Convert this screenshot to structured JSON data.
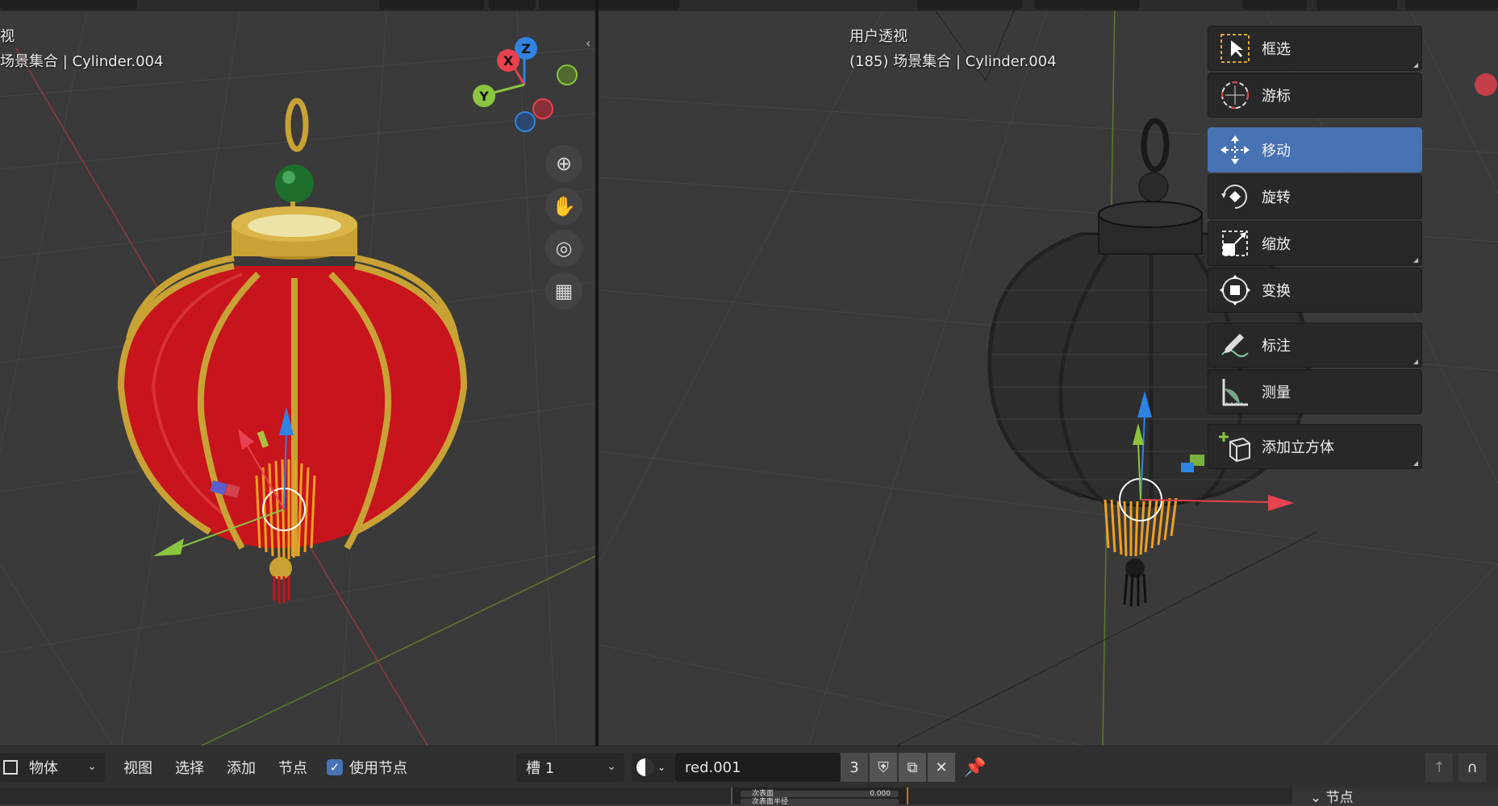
{
  "left_viewport": {
    "view_name": "视",
    "collection_info": "场景集合 | Cylinder.004",
    "gizmo_labels": {
      "z": "Z",
      "x": "X",
      "y": "Y"
    }
  },
  "right_viewport": {
    "view_name": "用户透视",
    "collection_info": "(185) 场景集合 | Cylinder.004"
  },
  "toolbar": {
    "items": [
      {
        "label": "框选",
        "icon": "select-box-icon"
      },
      {
        "label": "游标",
        "icon": "cursor-icon"
      },
      {
        "label": "移动",
        "icon": "move-icon",
        "active": true
      },
      {
        "label": "旋转",
        "icon": "rotate-icon"
      },
      {
        "label": "缩放",
        "icon": "scale-icon"
      },
      {
        "label": "变换",
        "icon": "transform-icon"
      },
      {
        "label": "标注",
        "icon": "annotate-icon"
      },
      {
        "label": "测量",
        "icon": "measure-icon"
      },
      {
        "label": "添加立方体",
        "icon": "add-cube-icon"
      }
    ]
  },
  "footer": {
    "object_mode": "物体",
    "menu": {
      "view": "视图",
      "select": "选择",
      "add": "添加",
      "node": "节点"
    },
    "use_nodes_label": "使用节点",
    "slot": "槽 1",
    "material_name": "red.001",
    "user_count": "3"
  },
  "bottom_strip": {
    "node_panel_label": "节点",
    "mini_field_1_label": "次表面",
    "mini_field_1_value": "0.000",
    "mini_field_2_label": "次表面半径"
  },
  "colors": {
    "accent": "#4772b3",
    "viewport_bg": "#3a3a3a",
    "axis_x": "#e8414f",
    "axis_y": "#8bc53f",
    "axis_z": "#2f84e3",
    "lantern_red": "#c8141c",
    "lantern_gold": "#c9a235",
    "tassel_orange": "#f0a020"
  }
}
